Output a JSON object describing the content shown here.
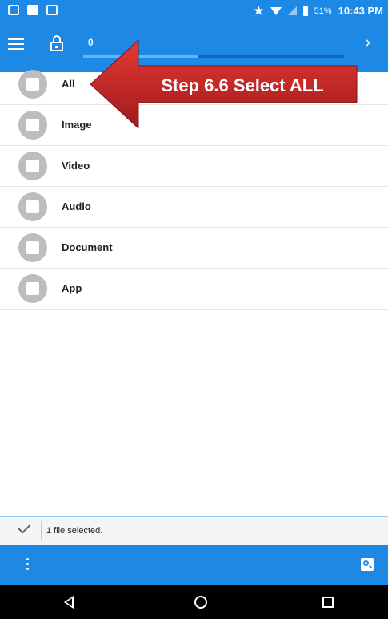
{
  "status_bar": {
    "battery": "51%",
    "time": "10:43 PM",
    "icons": [
      "image-notification-icon",
      "outlook-icon",
      "mail-icon",
      "star-icon",
      "wifi-icon",
      "signal-icon",
      "battery-icon"
    ]
  },
  "toolbar": {
    "counter": "0",
    "progress_fraction": 0.44,
    "icons": [
      "menu-icon",
      "lock-icon",
      "chevron-right-icon"
    ]
  },
  "categories": [
    {
      "label": "All",
      "icon": "folder-icon"
    },
    {
      "label": "Image",
      "icon": "image-icon"
    },
    {
      "label": "Video",
      "icon": "video-icon"
    },
    {
      "label": "Audio",
      "icon": "audio-icon"
    },
    {
      "label": "Document",
      "icon": "document-icon"
    },
    {
      "label": "App",
      "icon": "app-icon"
    }
  ],
  "callout": {
    "text": "Step 6.6 Select ALL",
    "color": "#c62828"
  },
  "selection": {
    "text": "1 file selected."
  },
  "colors": {
    "accent": "#1e88e5",
    "icon_circle": "#bdbdbd"
  }
}
